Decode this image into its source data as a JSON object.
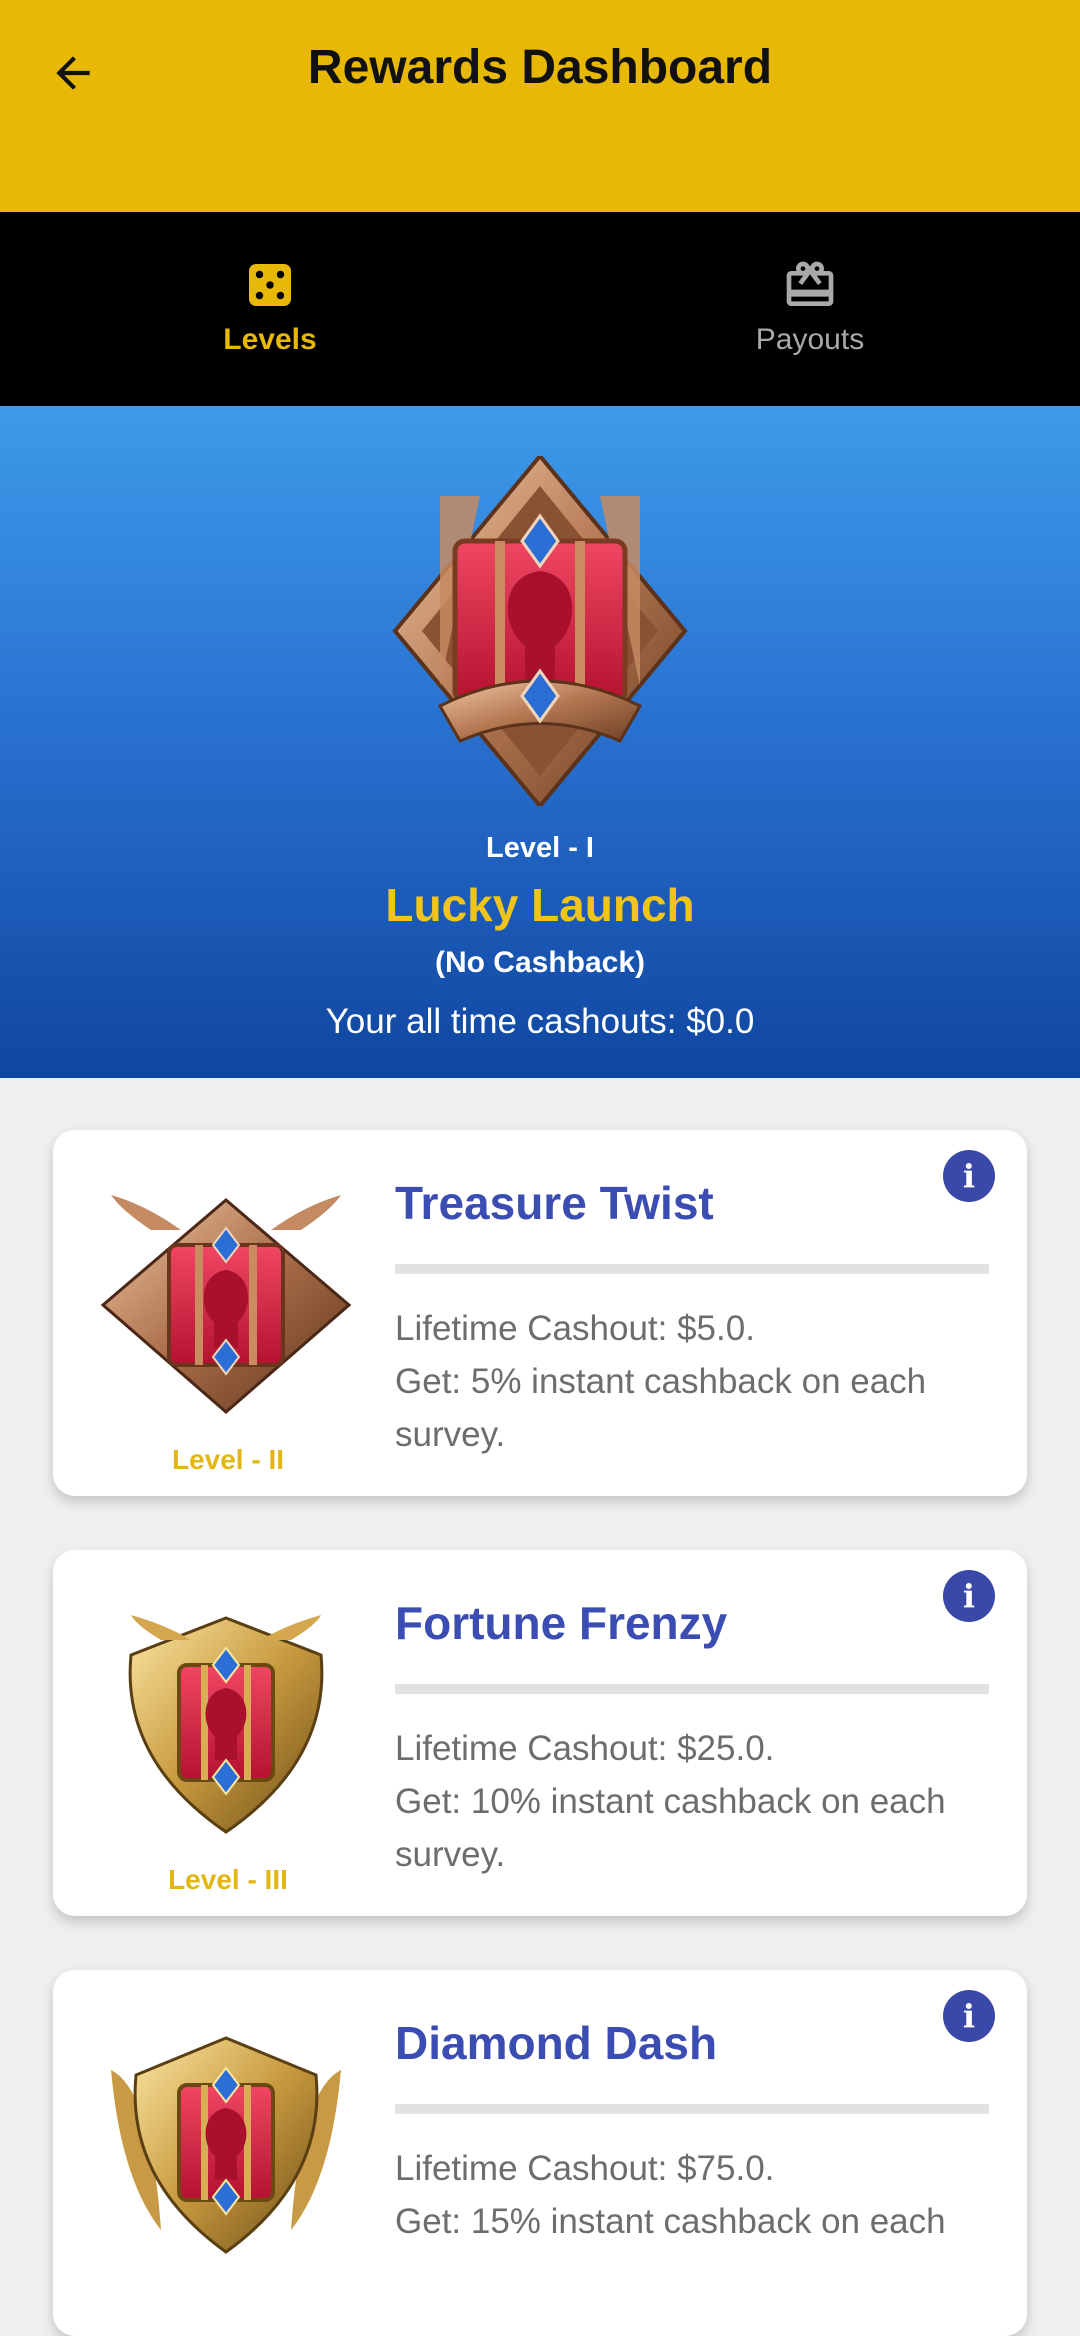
{
  "appbar": {
    "title": "Rewards Dashboard",
    "back_icon": "arrow-left-icon",
    "color": "#e8b807"
  },
  "tabs": [
    {
      "label": "Levels",
      "icon": "dice-icon",
      "active": true
    },
    {
      "label": "Payouts",
      "icon": "gift-card-icon",
      "active": false
    }
  ],
  "current_level": {
    "level": "Level - I",
    "name": "Lucky Launch",
    "note": "(No Cashback)",
    "cashouts": "Your all time cashouts: $0.0",
    "badge_icon": "bronze-rank-badge-icon"
  },
  "levels": [
    {
      "title": "Treasure Twist",
      "level": "Level - II",
      "desc": "Lifetime Cashout: $5.0.\nGet: 5% instant cashback on each survey.",
      "info_icon": "info-icon"
    },
    {
      "title": "Fortune Frenzy",
      "level": "Level - III",
      "desc": "Lifetime Cashout: $25.0.\nGet: 10% instant cashback on each survey.",
      "info_icon": "info-icon"
    },
    {
      "title": "Diamond Dash",
      "level": "",
      "desc": "Lifetime Cashout: $75.0.\nGet: 15% instant cashback on each",
      "info_icon": "info-icon"
    }
  ],
  "colors": {
    "accent": "#e8b807",
    "title_blue": "#3b4db3",
    "info_blue": "#3a48a8"
  }
}
